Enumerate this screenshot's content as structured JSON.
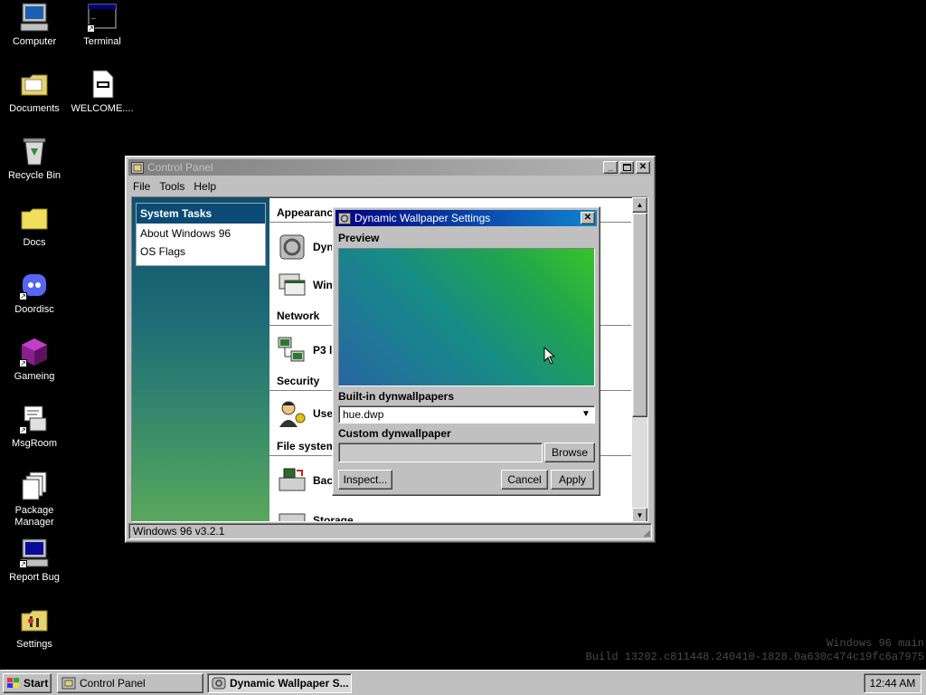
{
  "desktop": {
    "icons": [
      {
        "label": "Computer"
      },
      {
        "label": "Terminal"
      },
      {
        "label": "Documents"
      },
      {
        "label": "WELCOME...."
      },
      {
        "label": "Recycle Bin"
      },
      {
        "label": "Docs"
      },
      {
        "label": "Doordisc"
      },
      {
        "label": "Gameing"
      },
      {
        "label": "MsgRoom"
      },
      {
        "label": "Package Manager"
      },
      {
        "label": "Report Bug"
      },
      {
        "label": "Settings"
      }
    ],
    "watermark_line1": "Windows 96 main",
    "watermark_line2": "Build 13202.c811448.240410-1828.0a630c474c19fc6a7975"
  },
  "control_panel": {
    "title": "Control Panel",
    "menu": [
      "File",
      "Tools",
      "Help"
    ],
    "system_tasks": {
      "heading": "System Tasks",
      "items": [
        "About Windows 96",
        "OS Flags"
      ]
    },
    "sections": {
      "appearance": "Appearance",
      "network": "Network",
      "security": "Security",
      "file_system": "File system"
    },
    "items": {
      "dyn": "Dyn",
      "win": "Win",
      "p3": "P3 l",
      "use": "Use",
      "bac": "Bac",
      "storage": "Storage"
    },
    "status": "Windows 96 v3.2.1"
  },
  "dyn_wallpaper": {
    "title": "Dynamic Wallpaper Settings",
    "preview_label": "Preview",
    "builtin_label": "Built-in dynwallpapers",
    "builtin_value": "hue.dwp",
    "custom_label": "Custom dynwallpaper",
    "browse": "Browse",
    "inspect": "Inspect...",
    "cancel": "Cancel",
    "apply": "Apply"
  },
  "taskbar": {
    "start": "Start",
    "tasks": [
      {
        "label": "Control Panel",
        "active": false
      },
      {
        "label": "Dynamic Wallpaper S...",
        "active": true
      }
    ],
    "clock": "12:44 AM"
  }
}
